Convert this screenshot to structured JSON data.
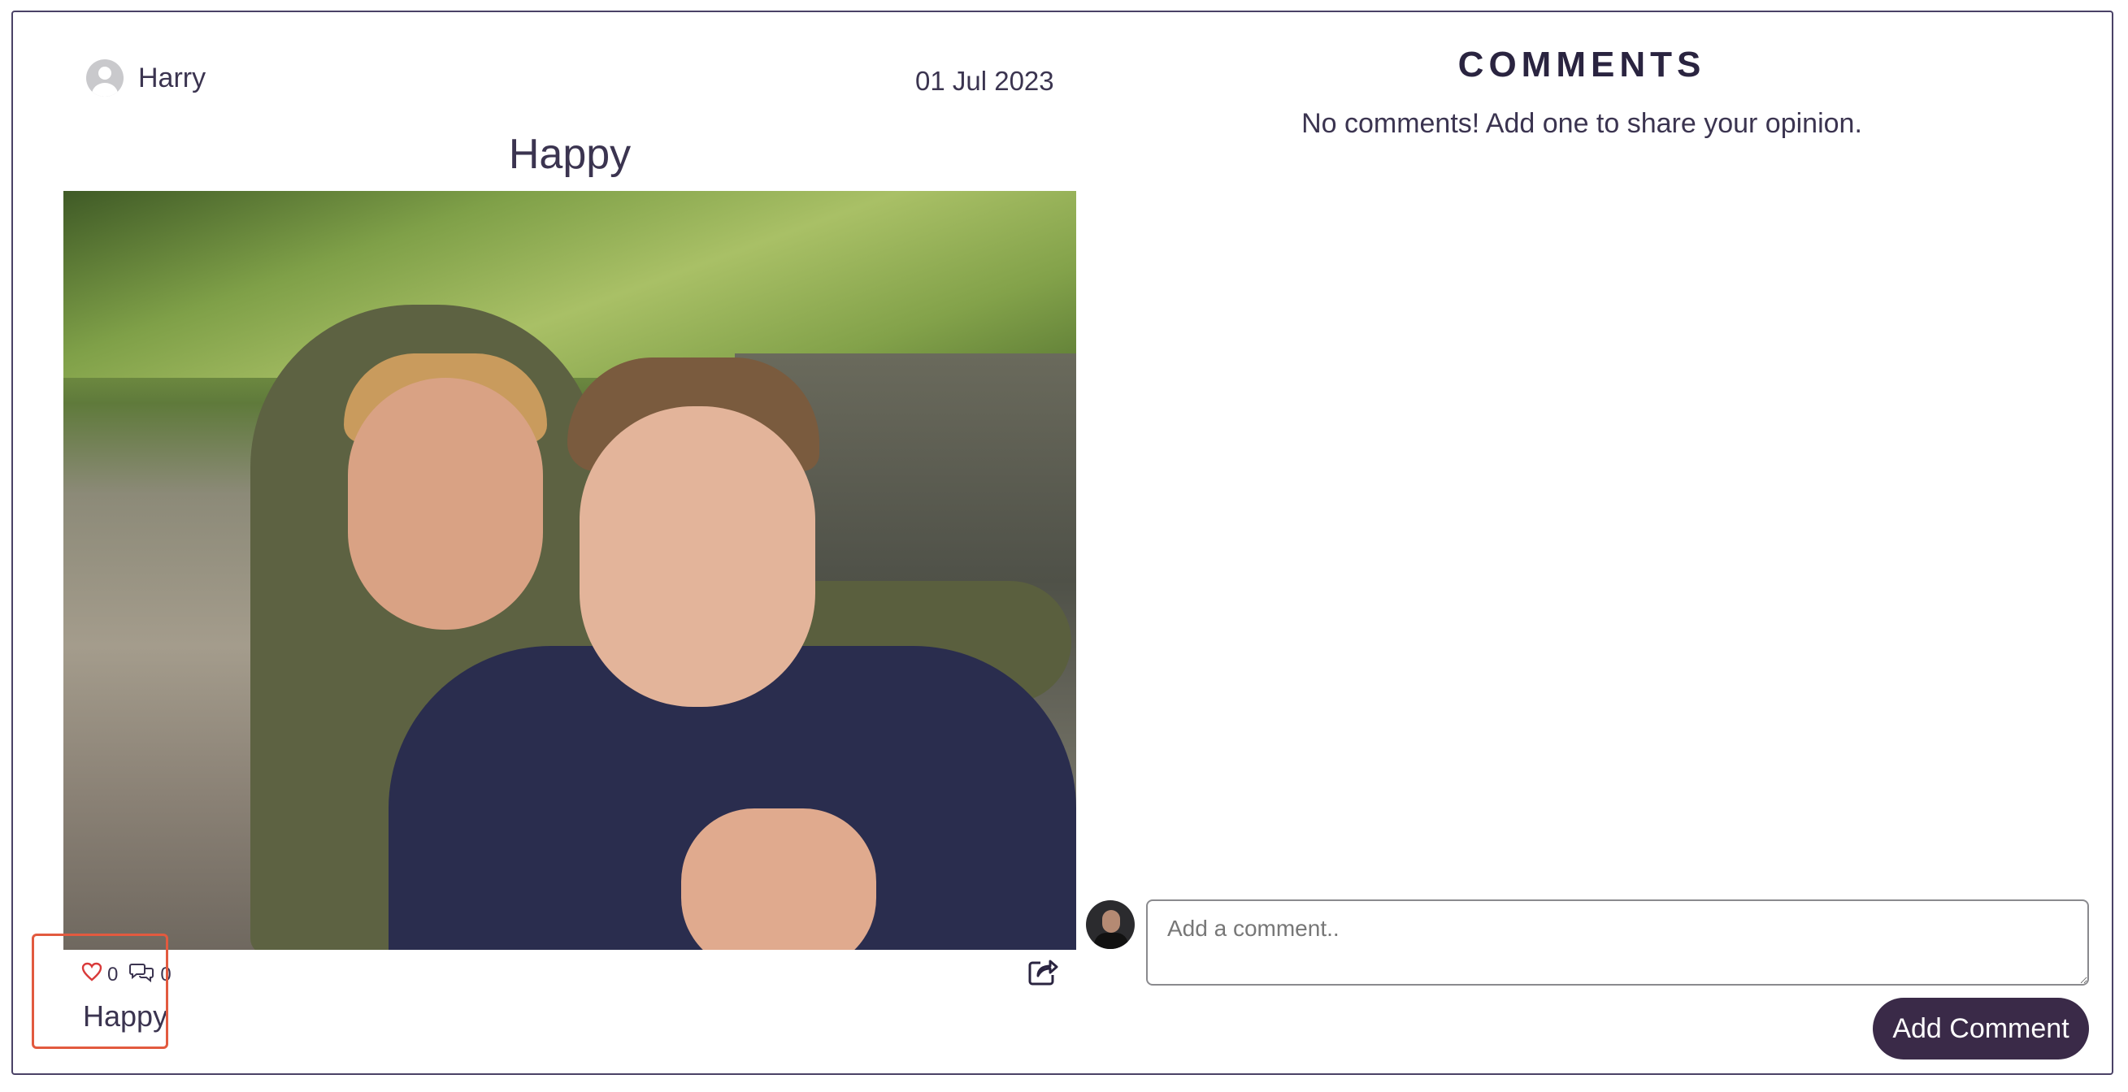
{
  "post": {
    "author": "Harry",
    "date": "01 Jul 2023",
    "title": "Happy",
    "caption": "Happy",
    "likes": "0",
    "comments_count": "0"
  },
  "comments_panel": {
    "title": "COMMENTS",
    "empty_message": "No comments! Add one to share your opinion.",
    "input_placeholder": "Add a comment..",
    "submit_label": "Add Comment"
  },
  "colors": {
    "accent_button": "#3a2a48",
    "highlight_box": "#e25a3f",
    "like_icon": "#d93a3a"
  },
  "icons": {
    "like": "heart-icon",
    "comment": "comment-bubbles-icon",
    "share": "share-icon"
  }
}
